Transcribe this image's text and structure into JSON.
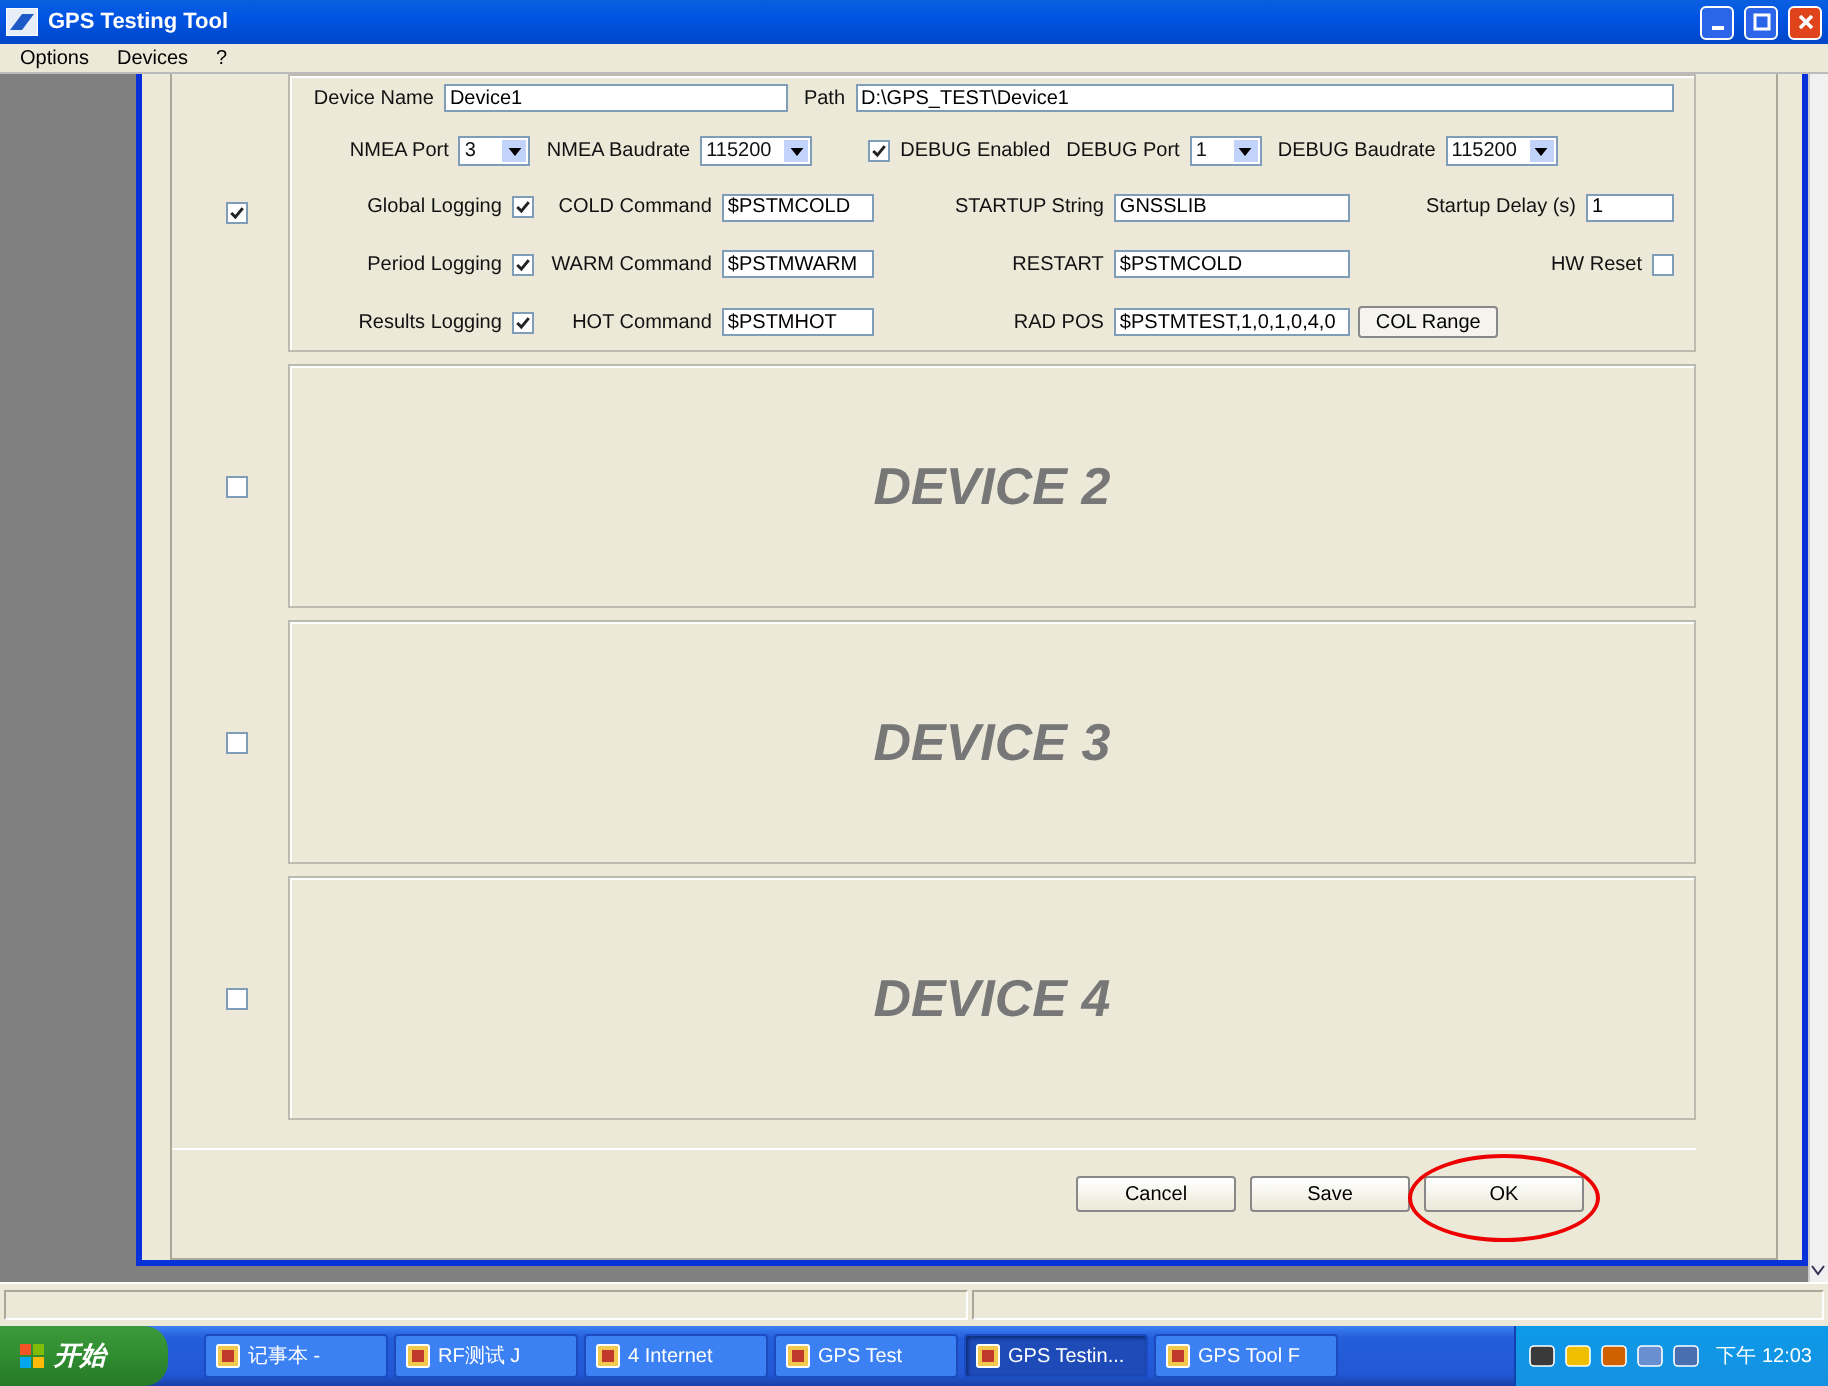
{
  "window": {
    "title": "GPS Testing Tool"
  },
  "menu": [
    {
      "label": "Options"
    },
    {
      "label": "Devices"
    },
    {
      "label": "?"
    }
  ],
  "devices": [
    {
      "kind": "form",
      "checked": true,
      "name_row": [
        {
          "kind": "input",
          "label": "Device Name",
          "value": "Device1"
        },
        {
          "kind": "input",
          "label": "Path",
          "value": "D:\\GPS_TEST\\Device1"
        }
      ],
      "port_row": [
        {
          "kind": "select",
          "label": "NMEA Port",
          "value": "3"
        },
        {
          "kind": "select",
          "label": "NMEA Baudrate",
          "value": "115200"
        },
        {
          "kind": "check",
          "label": "DEBUG Enabled",
          "checked": true
        },
        {
          "kind": "select",
          "label": "DEBUG Port",
          "value": "1"
        },
        {
          "kind": "select",
          "label": "DEBUG Baudrate",
          "value": "115200"
        }
      ],
      "options": [
        [
          {
            "kind": "check",
            "label": "Global Logging",
            "checked": true
          },
          {
            "kind": "input",
            "label": "COLD Command",
            "value": "$PSTMCOLD"
          },
          {
            "kind": "input",
            "label": "STARTUP String",
            "value": "GNSSLIB"
          },
          {
            "kind": "input",
            "label": "Startup Delay (s)",
            "value": "1"
          }
        ],
        [
          {
            "kind": "check",
            "label": "Period Logging",
            "checked": true
          },
          {
            "kind": "input",
            "label": "WARM Command",
            "value": "$PSTMWARM"
          },
          {
            "kind": "input",
            "label": "RESTART",
            "value": "$PSTMCOLD"
          },
          {
            "kind": "check",
            "label": "HW Reset",
            "checked": false
          }
        ],
        [
          {
            "kind": "check",
            "label": "Results Logging",
            "checked": true
          },
          {
            "kind": "input",
            "label": "HOT Command",
            "value": "$PSTMHOT"
          },
          {
            "kind": "input",
            "label": "RAD POS",
            "value": "$PSTMTEST,1,0,1,0,4,0"
          },
          {
            "kind": "button",
            "label": "COL Range"
          }
        ]
      ]
    },
    {
      "kind": "placeholder",
      "checked": false,
      "title": "DEVICE 2"
    },
    {
      "kind": "placeholder",
      "checked": false,
      "title": "DEVICE 3"
    },
    {
      "kind": "placeholder",
      "checked": false,
      "title": "DEVICE 4"
    }
  ],
  "buttons": [
    {
      "label": "Cancel",
      "circled": false
    },
    {
      "label": "Save",
      "circled": false
    },
    {
      "label": "OK",
      "circled": true
    }
  ],
  "taskbar": {
    "start": "开始",
    "tasks": [
      {
        "label": "记事本 -",
        "selected": false
      },
      {
        "label": "RF测试 J",
        "selected": false
      },
      {
        "label": "4 Internet",
        "selected": false
      },
      {
        "label": "GPS Test",
        "selected": false
      },
      {
        "label": "GPS Testin...",
        "selected": true
      },
      {
        "label": "GPS Tool F",
        "selected": false
      }
    ],
    "clock": "下午 12:03"
  }
}
